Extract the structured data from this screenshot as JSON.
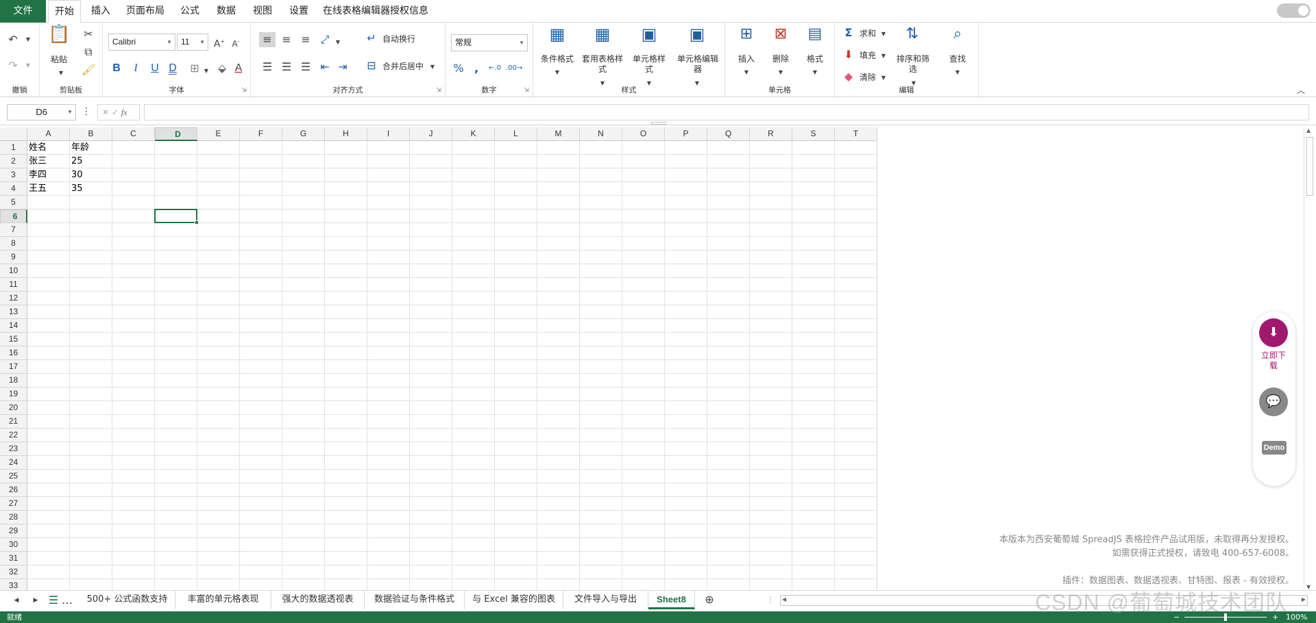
{
  "menu": {
    "tabs": [
      "文件",
      "开始",
      "插入",
      "页面布局",
      "公式",
      "数据",
      "视图",
      "设置",
      "在线表格编辑器授权信息"
    ]
  },
  "ribbon": {
    "undo_group": "撤销",
    "clipboard": {
      "label": "剪贴板",
      "paste": "粘贴"
    },
    "font": {
      "label": "字体",
      "font_name": "Calibri",
      "font_size": "11"
    },
    "alignment": {
      "label": "对齐方式",
      "wrap": "自动换行",
      "merge": "合并后居中"
    },
    "number": {
      "label": "数字",
      "format": "常规"
    },
    "styles": {
      "label": "样式",
      "cond_format": "条件格式",
      "table_style": "套用表格样式",
      "cell_style": "单元格样式",
      "cell_editor": "单元格编辑器"
    },
    "cells": {
      "label": "单元格",
      "insert": "插入",
      "delete": "删除",
      "format": "格式"
    },
    "editing": {
      "label": "编辑",
      "sum": "求和",
      "fill": "填充",
      "clear": "清除",
      "sort": "排序和筛选",
      "find": "查找"
    }
  },
  "formula_bar": {
    "name_box": "D6",
    "fx": "fx",
    "formula": ""
  },
  "grid": {
    "columns": [
      "A",
      "B",
      "C",
      "D",
      "E",
      "F",
      "G",
      "H",
      "I",
      "J",
      "K",
      "L",
      "M",
      "N",
      "O",
      "P",
      "Q",
      "R",
      "S",
      "T"
    ],
    "rows": [
      "1",
      "2",
      "3",
      "4",
      "5",
      "6",
      "7",
      "8",
      "9",
      "10",
      "11",
      "12",
      "13",
      "14",
      "15",
      "16",
      "17",
      "18",
      "19",
      "20",
      "21",
      "22",
      "23",
      "24",
      "25",
      "26",
      "27",
      "28",
      "29",
      "30",
      "31",
      "32",
      "33"
    ],
    "selected_cell": "D6",
    "cells": {
      "A1": "姓名",
      "B1": "年龄",
      "A2": "张三",
      "B2": "25",
      "A3": "李四",
      "B3": "30",
      "A4": "王五",
      "B4": "35"
    }
  },
  "float_panel": {
    "download": "立即下载",
    "demo": "Demo"
  },
  "notice": {
    "line1": "本版本为西安葡萄城 SpreadJS 表格控件产品试用版，未取得再分发授权。",
    "line2": "如需获得正式授权，请致电 400-657-6008。",
    "line3": "插件：数据图表、数据透视表、甘特图、报表 - 有效授权。"
  },
  "sheet_tabs": [
    "500+ 公式函数支持",
    "丰富的单元格表现",
    "强大的数据透视表",
    "数据验证与条件格式",
    "与 Excel 兼容的图表",
    "文件导入与导出",
    "Sheet8"
  ],
  "active_sheet": "Sheet8",
  "status": {
    "ready": "就绪",
    "zoom": "100%"
  },
  "watermark": "CSDN @葡萄城技术团队",
  "colors": {
    "accent": "#217346",
    "brand_panel": "#a0196e"
  }
}
